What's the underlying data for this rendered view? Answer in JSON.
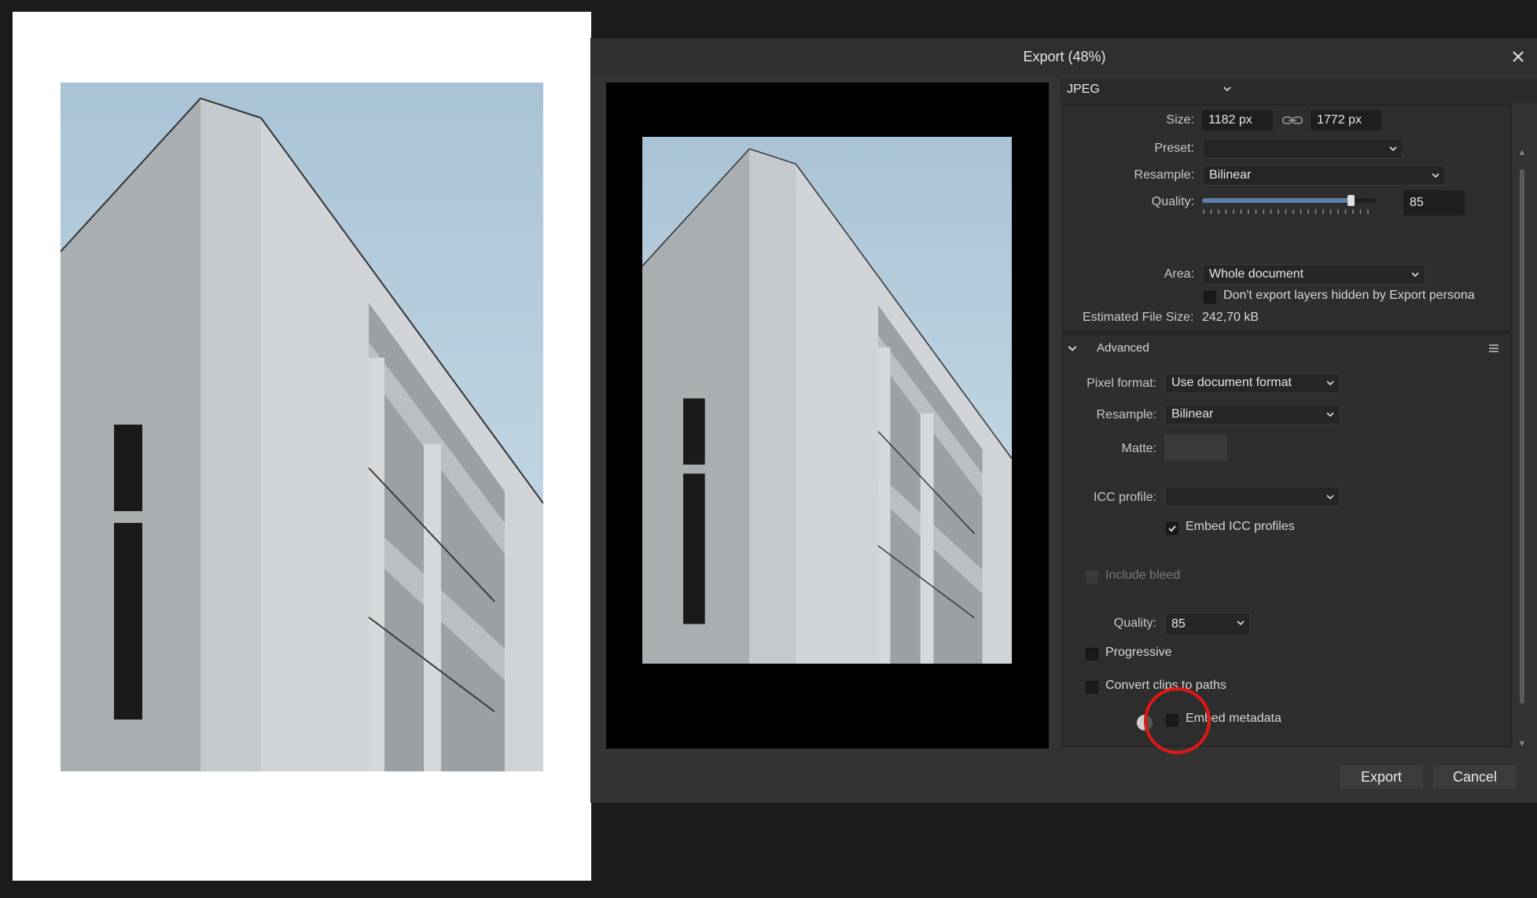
{
  "dialog": {
    "title": "Export (48%)",
    "close_icon": "close-icon",
    "format": "JPEG",
    "size": {
      "label": "Size:",
      "width": "1182 px",
      "height": "1772 px",
      "link_icon": "link-icon"
    },
    "preset": {
      "label": "Preset:",
      "value": ""
    },
    "resample": {
      "label": "Resample:",
      "value": "Bilinear"
    },
    "quality": {
      "label": "Quality:",
      "value": "85",
      "level": 0.85
    },
    "area": {
      "label": "Area:",
      "value": "Whole document"
    },
    "hidden_layers": {
      "label": "Don't export layers hidden by Export persona",
      "checked": false
    },
    "estimated_size": {
      "label": "Estimated File Size:",
      "value": "242,70 kB"
    },
    "advanced": {
      "title": "Advanced",
      "menu_icon": "hamburger-menu-icon",
      "pixel_format": {
        "label": "Pixel format:",
        "value": "Use document format"
      },
      "resample": {
        "label": "Resample:",
        "value": "Bilinear"
      },
      "matte": {
        "label": "Matte:"
      },
      "icc_profile": {
        "label": "ICC profile:",
        "value": ""
      },
      "embed_icc": {
        "label": "Embed ICC profiles",
        "checked": true
      },
      "include_bleed": {
        "label": "Include bleed",
        "checked": false,
        "disabled": true
      },
      "quality": {
        "label": "Quality:",
        "value": "85"
      },
      "progressive": {
        "label": "Progressive",
        "checked": false
      },
      "convert_clips": {
        "label": "Convert clips to paths",
        "checked": false
      },
      "embed_metadata": {
        "label": "Embed metadata",
        "checked": false
      }
    },
    "buttons": {
      "export": "Export",
      "cancel": "Cancel"
    }
  },
  "colors": {
    "highlight": "#e01818",
    "slider_fill": "#5b7fa8",
    "sky": "#b9d0df"
  }
}
